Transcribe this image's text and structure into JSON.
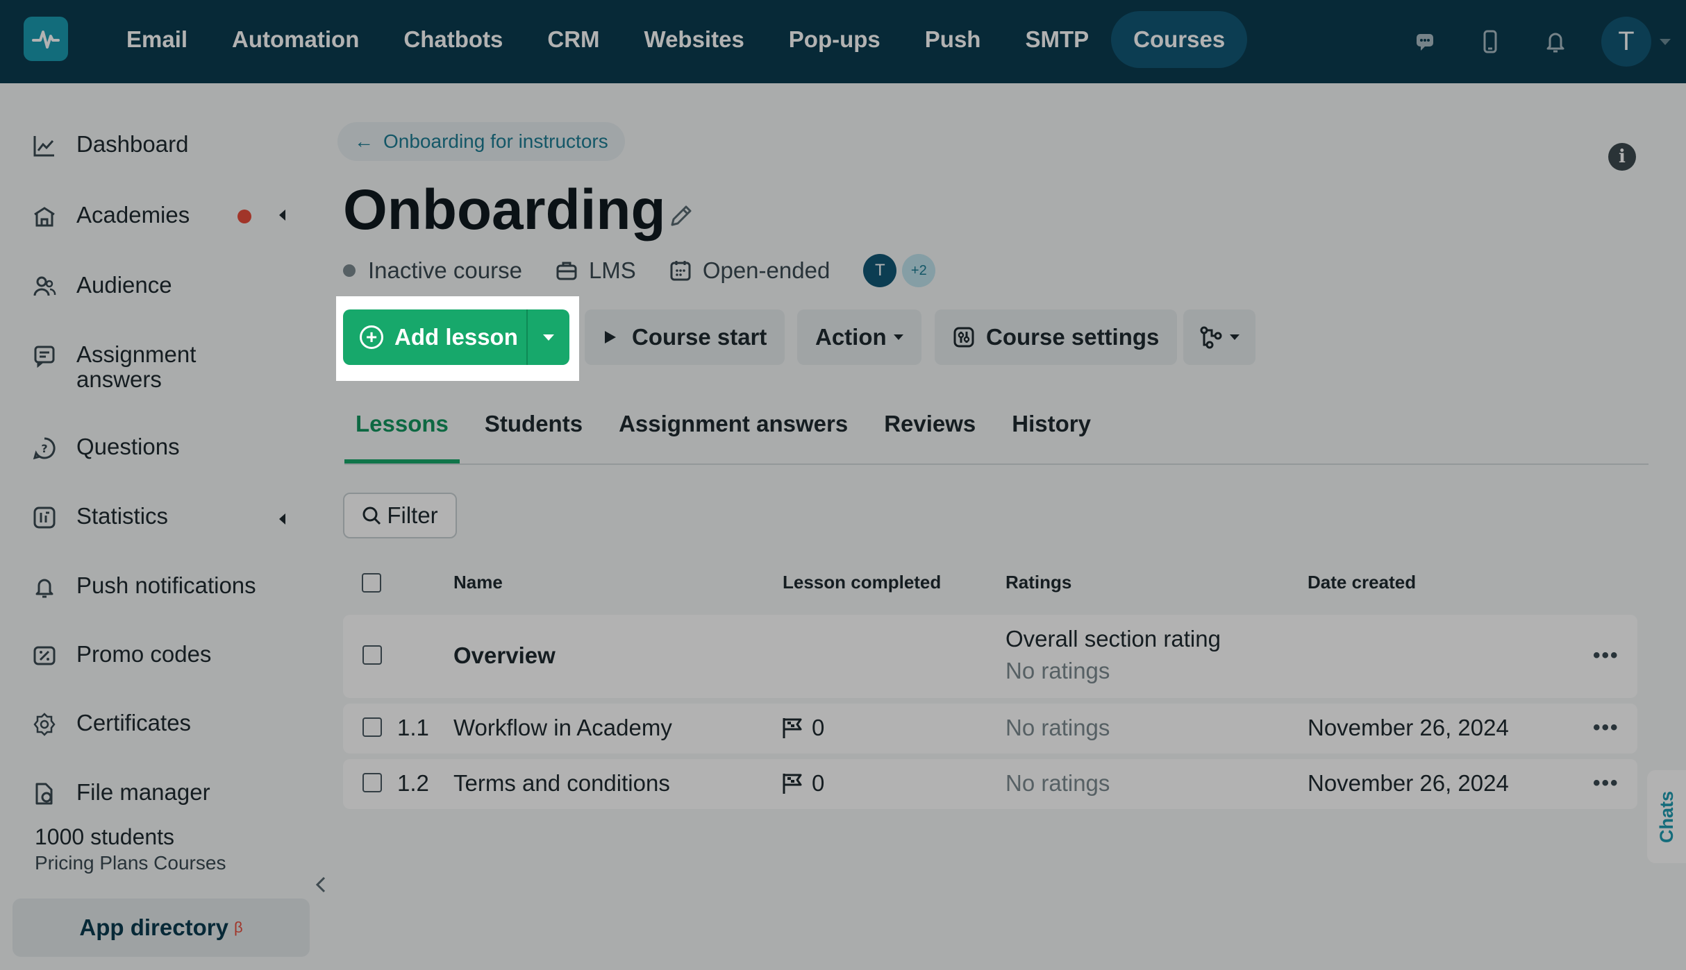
{
  "topnav": {
    "items": [
      "Email",
      "Automation",
      "Chatbots",
      "CRM",
      "Websites",
      "Pop-ups",
      "Push",
      "SMTP",
      "Courses"
    ],
    "active": "Courses",
    "avatar_initial": "T"
  },
  "sidebar": {
    "items": [
      {
        "label": "Dashboard",
        "icon": "chart-line-icon"
      },
      {
        "label": "Academies",
        "icon": "academy-icon"
      },
      {
        "label": "Audience",
        "icon": "users-icon"
      },
      {
        "label": "Assignment answers",
        "icon": "assignment-icon"
      },
      {
        "label": "Questions",
        "icon": "question-icon"
      },
      {
        "label": "Statistics",
        "icon": "statistics-icon"
      },
      {
        "label": "Push notifications",
        "icon": "bell-icon"
      },
      {
        "label": "Promo codes",
        "icon": "promo-icon"
      },
      {
        "label": "Certificates",
        "icon": "certificate-icon"
      },
      {
        "label": "File manager",
        "icon": "file-icon"
      }
    ],
    "plan_count": "1000 students",
    "plan_name": "Pricing Plans Courses",
    "app_directory": "App directory",
    "beta": "β"
  },
  "breadcrumb": {
    "label": "Onboarding for instructors",
    "arrow": "←"
  },
  "page": {
    "title": "Onboarding",
    "status": "Inactive course",
    "type": "LMS",
    "duration": "Open-ended",
    "avatar_initial": "T",
    "more_members": "+2"
  },
  "actions": {
    "add_lesson": "Add lesson",
    "course_start": "Course start",
    "action": "Action",
    "course_settings": "Course settings"
  },
  "tabs": [
    "Lessons",
    "Students",
    "Assignment answers",
    "Reviews",
    "History"
  ],
  "filter": {
    "label": "Filter"
  },
  "table": {
    "headers": {
      "name": "Name",
      "completed": "Lesson completed",
      "ratings": "Ratings",
      "date": "Date created"
    },
    "section": {
      "name": "Overview",
      "rating_label": "Overall section rating",
      "rating_value": "No ratings"
    },
    "rows": [
      {
        "num": "1.1",
        "name": "Workflow in Academy",
        "completed": "0",
        "rating": "No ratings",
        "date": "November 26, 2024"
      },
      {
        "num": "1.2",
        "name": "Terms and conditions",
        "completed": "0",
        "rating": "No ratings",
        "date": "November 26, 2024"
      }
    ],
    "more": "•••"
  },
  "chats": {
    "label": "Chats"
  },
  "colors": {
    "topbar": "#0b3b4f",
    "accent": "#17a86b",
    "link": "#1e7d94",
    "badge": "#e74c3c"
  }
}
